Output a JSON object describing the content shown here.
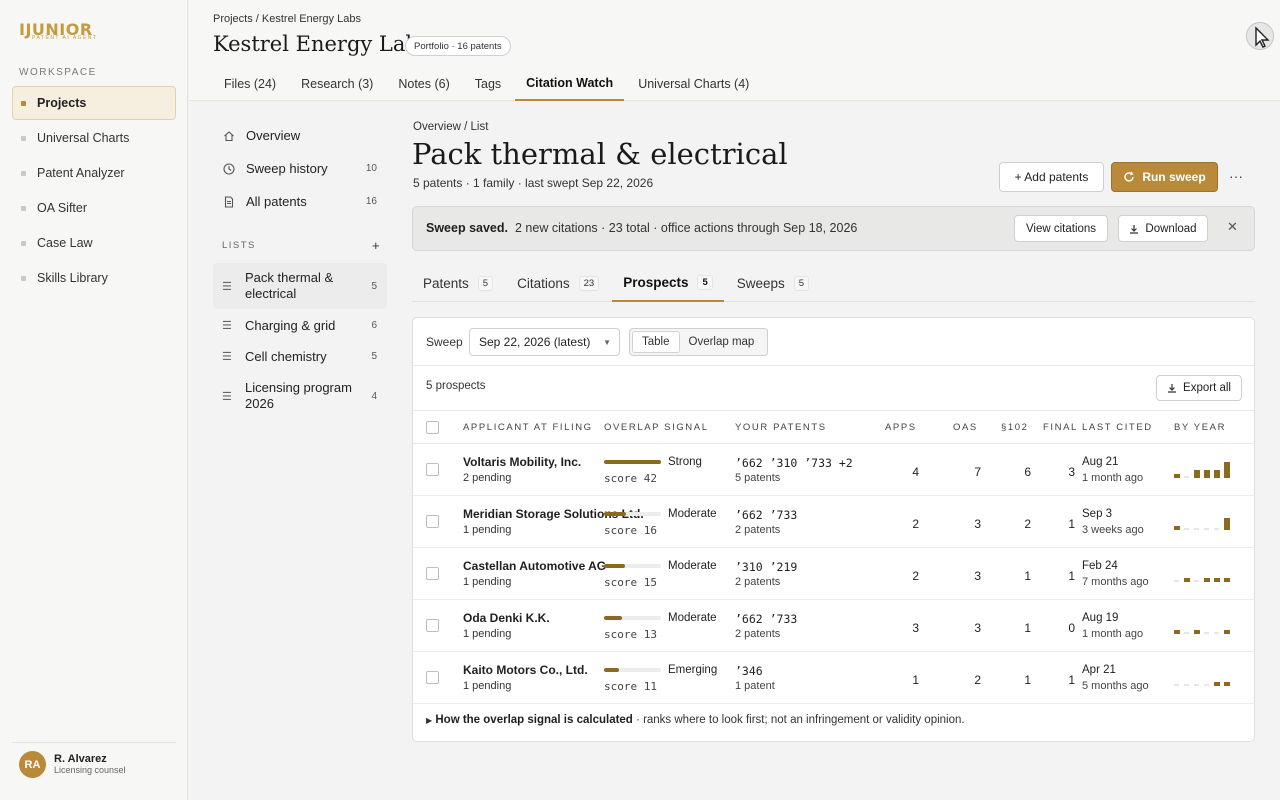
{
  "logo": {
    "main": "IJUNIOR",
    "sub": "PATENT AI AGENT"
  },
  "sidebar": {
    "workspace_label": "WORKSPACE",
    "items": [
      {
        "label": "Projects"
      },
      {
        "label": "Universal Charts"
      },
      {
        "label": "Patent Analyzer"
      },
      {
        "label": "OA Sifter"
      },
      {
        "label": "Case Law"
      },
      {
        "label": "Skills Library"
      }
    ],
    "user": {
      "initials": "RA",
      "name": "R. Alvarez",
      "role": "Licensing counsel"
    }
  },
  "header": {
    "breadcrumb": "Projects / Kestrel Energy Labs",
    "title": "Kestrel Energy Labs",
    "badge": "Portfolio · 16 patents",
    "tabs": [
      {
        "label": "Files (24)"
      },
      {
        "label": "Research (3)"
      },
      {
        "label": "Notes (6)"
      },
      {
        "label": "Tags"
      },
      {
        "label": "Citation Watch"
      },
      {
        "label": "Universal Charts (4)"
      }
    ]
  },
  "subnav": {
    "items": [
      {
        "label": "Overview",
        "count": ""
      },
      {
        "label": "Sweep history",
        "count": "10"
      },
      {
        "label": "All patents",
        "count": "16"
      }
    ],
    "lists_label": "LISTS",
    "lists_add": "+",
    "lists": [
      {
        "label": "Pack thermal & electrical",
        "count": "5"
      },
      {
        "label": "Charging & grid",
        "count": "6"
      },
      {
        "label": "Cell chemistry",
        "count": "5"
      },
      {
        "label": "Licensing program 2026",
        "count": "4"
      }
    ]
  },
  "main": {
    "crumb": "Overview / List",
    "title": "Pack thermal & electrical",
    "subtitle": "5 patents · 1 family · last swept Sep 22, 2026",
    "add_patents": "+ Add patents",
    "run_sweep": "Run sweep",
    "more": "···",
    "banner": {
      "bold": "Sweep saved.",
      "text": "2 new citations · 23 total · office actions through Sep 18, 2026",
      "view": "View citations",
      "download": "Download",
      "close": "✕"
    },
    "tabs": [
      {
        "label": "Patents",
        "count": "5"
      },
      {
        "label": "Citations",
        "count": "23"
      },
      {
        "label": "Prospects",
        "count": "5"
      },
      {
        "label": "Sweeps",
        "count": "5"
      }
    ],
    "sweep_label": "Sweep",
    "sweep_value": "Sep 22, 2026 (latest)",
    "views": [
      "Table",
      "Overlap map"
    ],
    "prospect_count": "5 prospects",
    "export": "Export all",
    "columns": [
      "APPLICANT AT FILING",
      "OVERLAP SIGNAL",
      "YOUR PATENTS",
      "APPS",
      "OAS",
      "§102",
      "FINAL",
      "LAST CITED",
      "BY YEAR"
    ],
    "rows": [
      {
        "name": "Voltaris Mobility, Inc.",
        "pending": "2 pending",
        "score": "score 42",
        "score_fraction": 1.0,
        "signal": "Strong",
        "patents": "’662  ’310  ’733 +2",
        "patents_sub": "5 patents",
        "apps": "4",
        "oas": "7",
        "s102": "6",
        "final": "3",
        "date": "Aug 21",
        "ago": "1 month ago",
        "years": [
          1,
          0,
          2,
          2,
          2,
          4
        ]
      },
      {
        "name": "Meridian Storage Solutions Ltd.",
        "pending": "1 pending",
        "score": "score 16",
        "score_fraction": 0.38,
        "signal": "Moderate",
        "patents": "’662  ’733",
        "patents_sub": "2 patents",
        "apps": "2",
        "oas": "3",
        "s102": "2",
        "final": "1",
        "date": "Sep 3",
        "ago": "3 weeks ago",
        "years": [
          1,
          0,
          0,
          0,
          0,
          3
        ]
      },
      {
        "name": "Castellan Automotive AG",
        "pending": "1 pending",
        "score": "score 15",
        "score_fraction": 0.36,
        "signal": "Moderate",
        "patents": "’310  ’219",
        "patents_sub": "2 patents",
        "apps": "2",
        "oas": "3",
        "s102": "1",
        "final": "1",
        "date": "Feb 24",
        "ago": "7 months ago",
        "years": [
          0,
          1,
          0,
          1,
          1,
          1
        ]
      },
      {
        "name": "Oda Denki K.K.",
        "pending": "1 pending",
        "score": "score 13",
        "score_fraction": 0.31,
        "signal": "Moderate",
        "patents": "’662  ’733",
        "patents_sub": "2 patents",
        "apps": "3",
        "oas": "3",
        "s102": "1",
        "final": "0",
        "date": "Aug 19",
        "ago": "1 month ago",
        "years": [
          1,
          0,
          1,
          0,
          0,
          1
        ]
      },
      {
        "name": "Kaito Motors Co., Ltd.",
        "pending": "1 pending",
        "score": "score 11",
        "score_fraction": 0.26,
        "signal": "Emerging",
        "patents": "’346",
        "patents_sub": "1 patent",
        "apps": "1",
        "oas": "2",
        "s102": "1",
        "final": "1",
        "date": "Apr 21",
        "ago": "5 months ago",
        "years": [
          0,
          0,
          0,
          0,
          1,
          1
        ]
      }
    ],
    "footnote_bold": "How the overlap signal is calculated",
    "footnote_text": " · ranks where to look first; not an infringement or validity opinion."
  },
  "colors": {
    "accent": "#b98a3a",
    "bar": "#8a6a1e"
  }
}
